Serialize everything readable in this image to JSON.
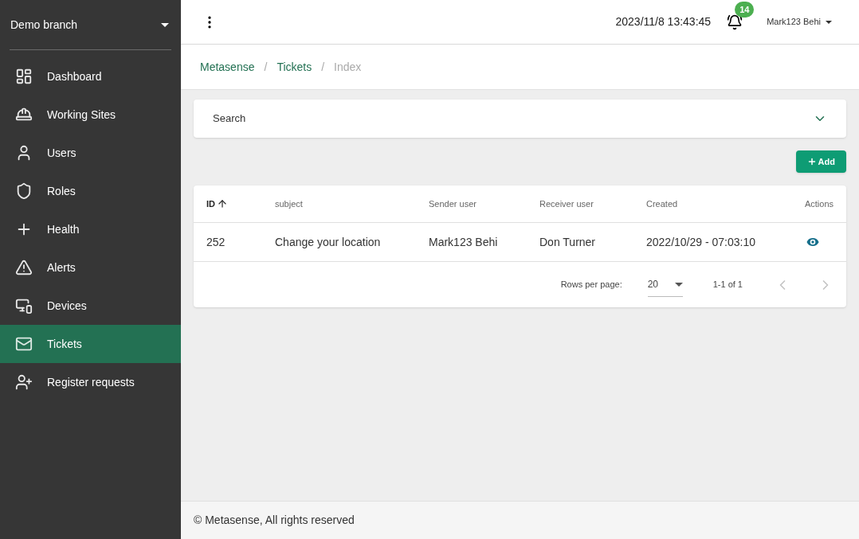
{
  "sidebar": {
    "branch": "Demo branch",
    "items": [
      {
        "label": "Dashboard",
        "selected": false
      },
      {
        "label": "Working Sites",
        "selected": false
      },
      {
        "label": "Users",
        "selected": false
      },
      {
        "label": "Roles",
        "selected": false
      },
      {
        "label": "Health",
        "selected": false
      },
      {
        "label": "Alerts",
        "selected": false
      },
      {
        "label": "Devices",
        "selected": false
      },
      {
        "label": "Tickets",
        "selected": true
      },
      {
        "label": "Register requests",
        "selected": false
      }
    ]
  },
  "topbar": {
    "datetime": "2023/11/8 13:43:45",
    "notifications": "14",
    "user": "Mark123 Behi"
  },
  "breadcrumb_separator": "/",
  "breadcrumb": [
    {
      "label": "Metasense",
      "current": false
    },
    {
      "label": "Tickets",
      "current": false
    },
    {
      "label": "Index",
      "current": true
    }
  ],
  "search": {
    "label": "Search",
    "expanded": false
  },
  "add_button": "Add",
  "table": {
    "columns": [
      {
        "label": "ID",
        "sorted": true
      },
      {
        "label": "subject",
        "sorted": false
      },
      {
        "label": "Sender user",
        "sorted": false
      },
      {
        "label": "Receiver user",
        "sorted": false
      },
      {
        "label": "Created",
        "sorted": false
      },
      {
        "label": "Actions",
        "sorted": false
      }
    ],
    "rows": [
      {
        "cells": [
          "252",
          "Change your location",
          "Mark123 Behi",
          "Don Turner",
          "2022/10/29 - 07:03:10"
        ]
      }
    ]
  },
  "pagination": {
    "rows_per_page_label": "Rows per page:",
    "rows_per_page": "20",
    "range": "1-1 of 1",
    "prev_disabled": true,
    "next_disabled": true
  },
  "footer": "© Metasense, All rights reserved"
}
